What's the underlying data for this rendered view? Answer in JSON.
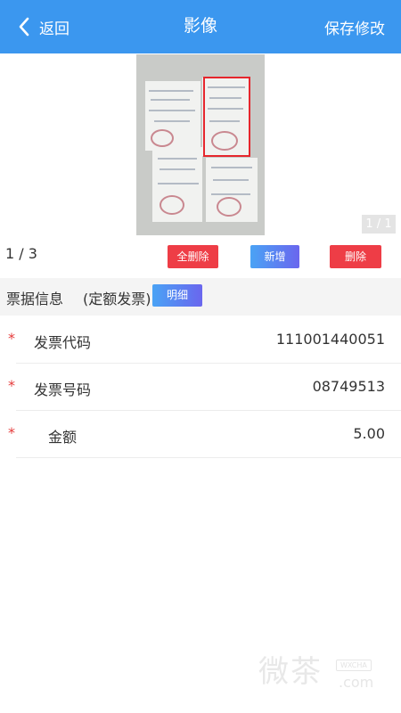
{
  "header": {
    "back_label": "返回",
    "title": "影像",
    "save_label": "保存修改",
    "background_color": "#3b97ef"
  },
  "image_viewer": {
    "page_indicator": "1 / 1"
  },
  "pager": {
    "text": "1 / 3"
  },
  "toolbar": {
    "delete_all_label": "全删除",
    "add_label": "新增",
    "delete_label": "删除"
  },
  "section": {
    "title": "票据信息",
    "invoice_type": "(定额发票)",
    "detail_label": "明细"
  },
  "fields": [
    {
      "label": "发票代码",
      "value": "111001440051",
      "required": "*"
    },
    {
      "label": "发票号码",
      "value": "08749513",
      "required": "*"
    },
    {
      "label": "金额",
      "value": "5.00",
      "required": "*"
    }
  ],
  "watermark": {
    "text": "微茶",
    "badge": "WXCHA",
    "domain": ".com"
  },
  "colors": {
    "accent_blue": "#3b97ef",
    "danger_red": "#ee3d46",
    "required_star": "#e53b3b"
  }
}
